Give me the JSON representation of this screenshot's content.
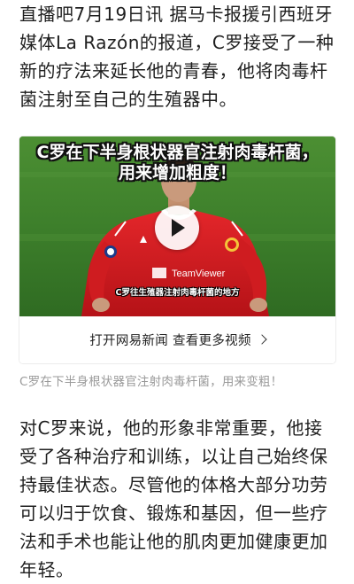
{
  "article": {
    "paragraph_1": "直播吧7月19日讯 据马卡报援引西班牙媒体La Razón的报道，C罗接受了一种新的疗法来延长他的青春，他将肉毒杆菌注射至自己的生殖器中。",
    "paragraph_2": "对C罗来说，他的形象非常重要，他接受了各种治疗和训练，以让自己始终保持最佳状态。尽管他的体格大部分功劳可以归于饮食、锻炼和基因，但一些疗法和手术也能让他的肌肉更加健康更加年轻。"
  },
  "video": {
    "overlay_title_line1": "C罗在下半身根状器官注射肉毒杆菌，",
    "overlay_title_line2": "用来增加粗度！",
    "subtitle_caption": "C罗往生殖器注射肉毒杆菌的地方",
    "jersey_sponsor": "TeamViewer",
    "play_icon": "play-icon",
    "footer_label": "打开网易新闻 查看更多视频",
    "footer_icon": "chevron-right-icon"
  },
  "image_caption": "C罗在下半身根状器官注射肉毒杆菌，用来变粗！",
  "colors": {
    "text": "#1f1f1f",
    "caption": "#9a9a9a",
    "jersey_red": "#d51a1c",
    "grass": "#3b7f2a"
  }
}
